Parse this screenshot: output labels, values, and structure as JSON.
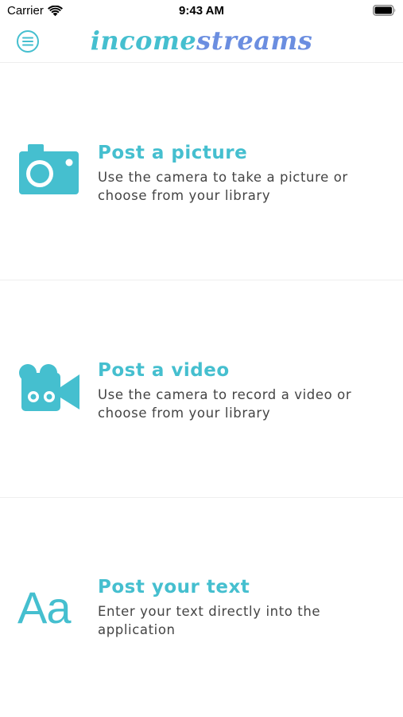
{
  "status_bar": {
    "carrier": "Carrier",
    "time": "9:43 AM",
    "icons": [
      "wifi-icon",
      "battery-icon"
    ]
  },
  "header": {
    "title_part1": "income",
    "title_part2": "streams",
    "menu_icon": "hamburger-menu-icon"
  },
  "colors": {
    "accent": "#45bfcf",
    "accent_secondary": "#6b8ee0",
    "text_secondary": "#444444",
    "divider": "#efefef"
  },
  "options": [
    {
      "icon": "camera-icon",
      "title": "Post a picture",
      "description": "Use the camera to take a picture or choose from your library"
    },
    {
      "icon": "video-camera-icon",
      "title": "Post a video",
      "description": "Use the camera to record a video or choose from your library"
    },
    {
      "icon": "text-aa-icon",
      "icon_glyph": "Aa",
      "title": "Post your text",
      "description": "Enter your text directly into the application"
    }
  ]
}
